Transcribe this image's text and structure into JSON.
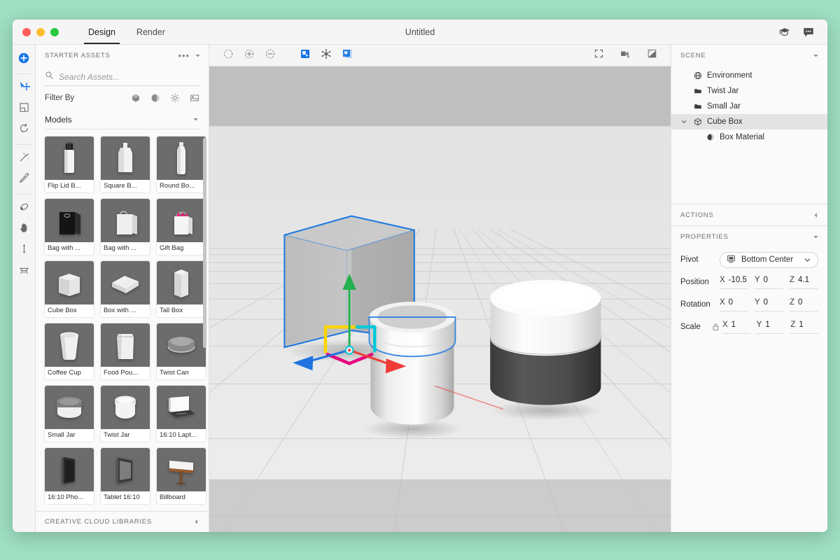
{
  "window": {
    "title": "Untitled",
    "tabs": [
      {
        "label": "Design",
        "active": true
      },
      {
        "label": "Render",
        "active": false
      }
    ],
    "titlebar_icons": [
      "graduation-cap-icon",
      "chat-bubble-icon"
    ],
    "traffic_lights": [
      "close",
      "minimize",
      "maximize"
    ]
  },
  "tool_rail": {
    "items": [
      {
        "name": "add-object-tool",
        "icon": "plus-circle-icon",
        "accent": true
      },
      {
        "name": "select-move-tool",
        "icon": "cursor-move-icon",
        "accent": true
      },
      {
        "name": "scale-tool",
        "icon": "scale-box-icon",
        "accent": false
      },
      {
        "name": "rotate-tool",
        "icon": "rotate-icon",
        "accent": false
      },
      {
        "name": "magic-wand-tool",
        "icon": "magic-wand-icon",
        "accent": false
      },
      {
        "name": "eyedropper-tool",
        "icon": "eyedropper-icon",
        "accent": false
      },
      {
        "name": "orbit-tool",
        "icon": "orbit-icon",
        "accent": false
      },
      {
        "name": "pan-tool",
        "icon": "hand-icon",
        "accent": false
      },
      {
        "name": "dolly-tool",
        "icon": "vertical-arrows-icon",
        "accent": false
      },
      {
        "name": "camera-tool",
        "icon": "camera-stand-icon",
        "accent": false
      }
    ]
  },
  "assets_panel": {
    "header": "STARTER ASSETS",
    "more_label": "•••",
    "search": {
      "placeholder": "Search Assets...",
      "value": ""
    },
    "filter_label": "Filter By",
    "filter_icons": [
      "model-filter-icon",
      "material-filter-icon",
      "light-filter-icon",
      "image-filter-icon"
    ],
    "group_label": "Models",
    "footer": "CREATIVE CLOUD LIBRARIES",
    "models": [
      {
        "label": "Flip Lid B...",
        "shape": "flip-lid-bottle"
      },
      {
        "label": "Square B...",
        "shape": "square-bottle"
      },
      {
        "label": "Round Bo...",
        "shape": "round-bottle"
      },
      {
        "label": "Bag with ...",
        "shape": "dark-bag"
      },
      {
        "label": "Bag with ...",
        "shape": "light-bag"
      },
      {
        "label": "Gift Bag",
        "shape": "gift-bag"
      },
      {
        "label": "Cube Box",
        "shape": "cube-box"
      },
      {
        "label": "Box with ...",
        "shape": "flat-box"
      },
      {
        "label": "Tall Box",
        "shape": "tall-box"
      },
      {
        "label": "Coffee Cup",
        "shape": "coffee-cup"
      },
      {
        "label": "Food Pou...",
        "shape": "food-pouch"
      },
      {
        "label": "Twist Can",
        "shape": "twist-can"
      },
      {
        "label": "Small Jar",
        "shape": "small-jar"
      },
      {
        "label": "Twist Jar",
        "shape": "twist-jar"
      },
      {
        "label": "16:10 Lapt...",
        "shape": "laptop"
      },
      {
        "label": "16:10 Pho...",
        "shape": "phone"
      },
      {
        "label": "Tablet 16:10",
        "shape": "tablet"
      },
      {
        "label": "Billboard",
        "shape": "billboard"
      }
    ]
  },
  "viewport_toolbar": {
    "left_buttons": [
      {
        "name": "selection-marquee-tool",
        "icon": "dashed-circle-icon",
        "accent": false
      },
      {
        "name": "add-to-selection-tool",
        "icon": "circle-plus-icon",
        "accent": false
      },
      {
        "name": "remove-from-selection-tool",
        "icon": "circle-minus-icon",
        "accent": false
      },
      {
        "name": "object-select-mode",
        "icon": "object-select-icon",
        "accent": true
      },
      {
        "name": "scene-select-mode",
        "icon": "scene-nodes-icon",
        "accent": true
      },
      {
        "name": "group-select-mode",
        "icon": "group-select-icon",
        "accent": true
      }
    ],
    "right_buttons": [
      {
        "name": "fit-to-view-button",
        "icon": "fit-frame-icon"
      },
      {
        "name": "camera-views-button",
        "icon": "camera-views-icon"
      },
      {
        "name": "render-preview-button",
        "icon": "render-preview-icon"
      }
    ]
  },
  "scene": {
    "header": "SCENE",
    "items": [
      {
        "label": "Environment",
        "icon": "globe-icon",
        "indent": 0,
        "selected": false,
        "expandable": false
      },
      {
        "label": "Twist Jar",
        "icon": "folder-icon",
        "indent": 0,
        "selected": false,
        "expandable": false
      },
      {
        "label": "Small Jar",
        "icon": "folder-icon",
        "indent": 0,
        "selected": false,
        "expandable": false
      },
      {
        "label": "Cube Box",
        "icon": "cube-icon",
        "indent": 0,
        "selected": true,
        "expandable": true
      },
      {
        "label": "Box Material",
        "icon": "material-sphere-icon",
        "indent": 1,
        "selected": false,
        "expandable": false
      }
    ]
  },
  "actions": {
    "header": "ACTIONS"
  },
  "properties": {
    "header": "PROPERTIES",
    "pivot": {
      "label": "Pivot",
      "value": "Bottom Center",
      "icon": "pivot-bottom-center-icon"
    },
    "position": {
      "label": "Position",
      "x": "-10.5",
      "y": "0",
      "z": "4.1"
    },
    "rotation": {
      "label": "Rotation",
      "x": "0",
      "y": "0",
      "z": "0"
    },
    "scale": {
      "label": "Scale",
      "x": "1",
      "y": "1",
      "z": "1",
      "locked": true
    },
    "axis_labels": {
      "x": "X",
      "y": "Y",
      "z": "Z"
    }
  },
  "colors": {
    "desktop_background": "#9fdfc3",
    "accent_blue": "#1473e6",
    "panel_background": "#fafafa",
    "window_chrome": "#f5f5f5",
    "selection_outline": "#1f7ae0",
    "gizmo_y_green": "#22b14c",
    "gizmo_x_red": "#ef3b36",
    "gizmo_z_blue": "#1f74e0",
    "gizmo_plane_yellow": "#ffd400",
    "gizmo_plane_cyan": "#00c8d7",
    "gizmo_plane_magenta": "#e5007e",
    "traffic_red": "#ff5f57",
    "traffic_yellow": "#ffbd2e",
    "traffic_green": "#28c840",
    "viewport_backdrop_band": "#bfbfbf",
    "viewport_floor": "#e7e7e7"
  }
}
